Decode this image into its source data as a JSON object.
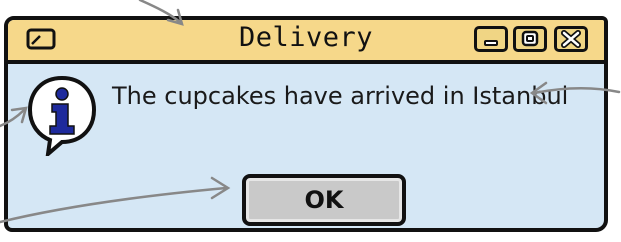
{
  "dialog": {
    "title": "Delivery",
    "message": "The cupcakes have arrived in Istanbul",
    "ok_label": "OK"
  },
  "icons": {
    "app": "window-icon",
    "info": "info-speech-bubble-icon",
    "minimize": "minimize-icon",
    "maximize": "maximize-icon",
    "close": "close-icon"
  },
  "colors": {
    "titlebar": "#f6d88a",
    "body": "#d5e7f5",
    "button": "#c9c9c9",
    "info_icon": "#1e2a9c"
  }
}
